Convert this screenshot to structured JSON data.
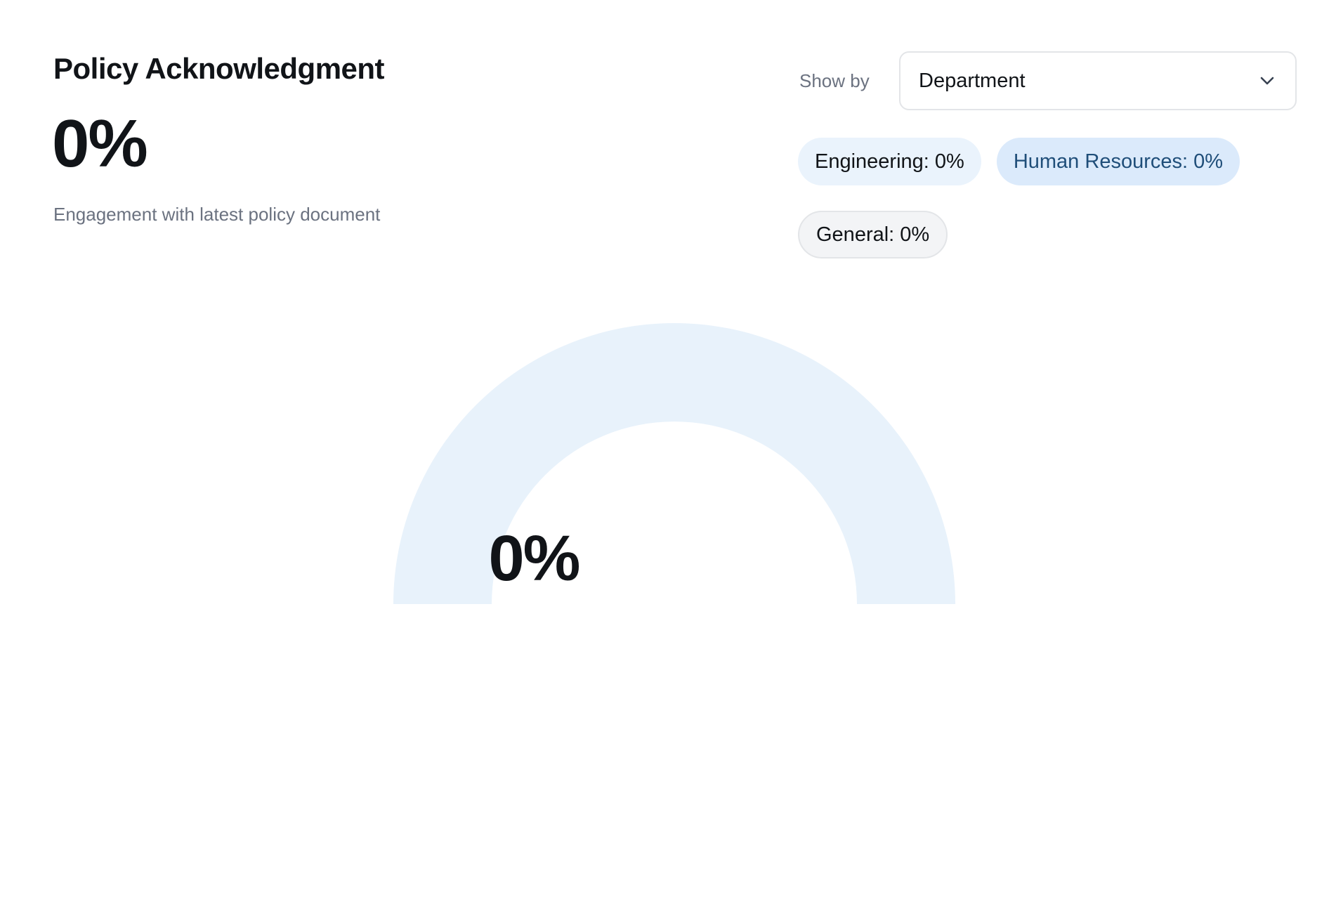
{
  "card": {
    "title": "Policy Acknowledgment",
    "value": "0%",
    "subtitle": "Engagement with latest policy document"
  },
  "filter": {
    "label": "Show by",
    "selected": "Department"
  },
  "chips": [
    {
      "label": "Engineering: 0%"
    },
    {
      "label": "Human Resources: 0%"
    },
    {
      "label": "General: 0%"
    }
  ],
  "gauge": {
    "value_label": "0%",
    "value": 0,
    "max": 100,
    "track_color": "#e8f2fb",
    "fill_color": "#2f6fb5"
  },
  "icons": {
    "select": "chevron-down-icon"
  }
}
